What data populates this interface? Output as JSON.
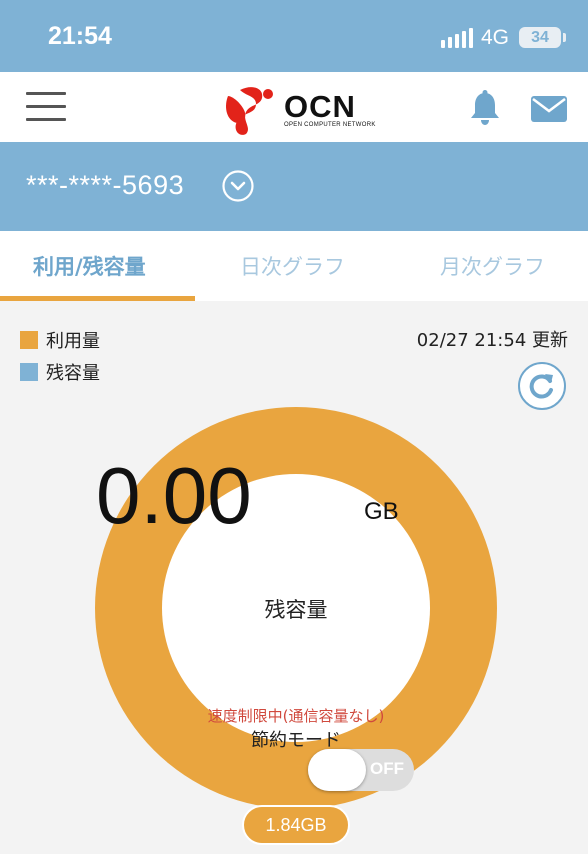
{
  "status_bar": {
    "time": "21:54",
    "network": "4G",
    "battery": "34"
  },
  "header": {
    "logo_text": "OCN",
    "logo_sub": "OPEN COMPUTER NETWORK",
    "icons": [
      "menu-icon",
      "bell-icon",
      "mail-icon"
    ]
  },
  "account": {
    "number": "***-****-5693",
    "icon": "chevron-down-circle-icon"
  },
  "tabs": [
    {
      "label": "利用/残容量",
      "active": true
    },
    {
      "label": "日次グラフ",
      "active": false
    },
    {
      "label": "月次グラフ",
      "active": false
    }
  ],
  "legend": [
    {
      "label": "利用量",
      "color": "#e9a53f"
    },
    {
      "label": "残容量",
      "color": "#7fb2d5"
    }
  ],
  "updated": "02/27 21:54 更新",
  "gauge": {
    "label": "残容量",
    "value": "0.00",
    "unit": "GB",
    "warning": "速度制限中(通信容量なし)",
    "used": "1.84GB"
  },
  "saving_mode": {
    "label": "節約モード",
    "state": "OFF"
  },
  "colors": {
    "accent_blue": "#7fb2d5",
    "accent_orange": "#e9a53f",
    "warning_red": "#d0493d"
  }
}
